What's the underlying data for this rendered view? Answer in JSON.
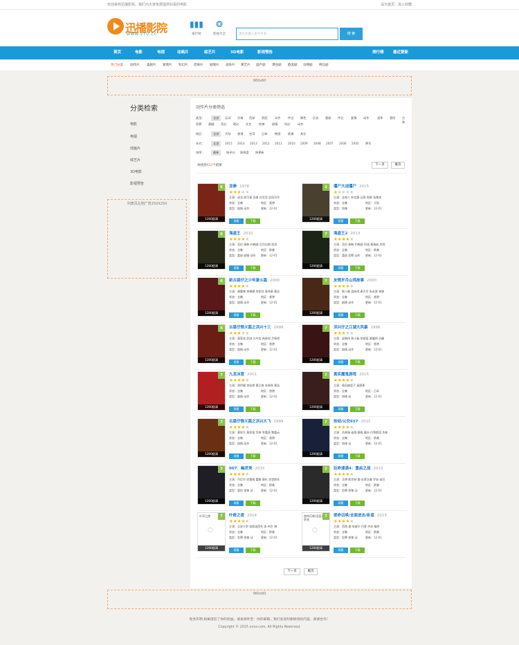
{
  "topbar": {
    "welcome": "欢迎来到迅播影院，我们为大家免费提供好看的电影",
    "links": "设为首页 · 加入收藏"
  },
  "header": {
    "logo_text": "迅播影院",
    "logo_url": "WWW.2TU.CC",
    "icon1_label": "排行榜",
    "icon2_label": "影视大全",
    "search_placeholder": "请在此输入影片片名",
    "search_button": "搜 索"
  },
  "nav": {
    "items": [
      "首页",
      "电影",
      "电视",
      "动画片",
      "综艺片",
      "3D电影",
      "影视预告"
    ],
    "right": [
      "排行榜",
      "最近更新"
    ]
  },
  "subnav": {
    "label": "热门分类：",
    "items": [
      "动作片",
      "喜剧片",
      "爱情片",
      "科幻片",
      "恐怖片",
      "剧情片",
      "战争片",
      "黄艺片",
      "国产剧",
      "港台剧",
      "欧美剧",
      "日韩剧",
      "韩马剧"
    ]
  },
  "ads": {
    "top": "960x60",
    "side": "列表页左侧广告250X250",
    "bottom": "960x60"
  },
  "sidebar": {
    "title": "分类检索",
    "links": [
      "电影",
      "电视",
      "动画片",
      "综艺片",
      "3D电影",
      "影视预告"
    ]
  },
  "filter": {
    "title": "动作片分类筛选",
    "type_label": "类型：",
    "type_items": [
      "全部",
      "运动",
      "灾难",
      "西部",
      "家庭",
      "动作",
      "传记",
      "情色",
      "历史",
      "喜剧",
      "传记",
      "爱情",
      "动作",
      "战争",
      "冒险",
      "古装",
      "犯罪",
      "悬疑",
      "奇幻",
      "歌幻",
      "文艺",
      "惊悚",
      "剧情",
      "科幻",
      "动作"
    ],
    "region_label": "地区：",
    "region_items": [
      "全部",
      "大陆",
      "香港",
      "台湾",
      "日本",
      "韩国",
      "欧美",
      "其它"
    ],
    "year_label": "年代：",
    "year_items": [
      "全部",
      "2015",
      "2014",
      "2013",
      "2012",
      "2011",
      "2010",
      "2009",
      "2008",
      "2007",
      "2006",
      "2005",
      "更早"
    ],
    "sort_label": "排序：",
    "sort_items": [
      "最新",
      "按评分",
      "按热度",
      "按更新"
    ]
  },
  "count": {
    "prefix": "共找到",
    "num": "922",
    "suffix": "个结果"
  },
  "pager": {
    "next": "下一页",
    "last": "尾页"
  },
  "labels": {
    "star": "主演：",
    "status": "状态：",
    "region": "地区：",
    "genre": "类型：",
    "update": "更新：",
    "watch": "观看",
    "download": "下载"
  },
  "movies": [
    {
      "title": "龙拳",
      "year": "1978",
      "rating": "6",
      "stars": 3,
      "actors": "成龙 邢可青 田俊 任世官 彭冈司华",
      "status": "全集",
      "region": "香港",
      "genre": "剧情 动作",
      "update": "12-01",
      "poster": "#7a2418"
    },
    {
      "title": "僵尸大战僵尸",
      "year": "2015",
      "rating": "2",
      "stars": 1,
      "actors": "金南人 朴信惠 吕燕 陈辉 张景良",
      "status": "全集",
      "region": "大陆",
      "genre": "惊悚",
      "update": "12-01",
      "poster": "#4a4030"
    },
    {
      "title": "海盗王",
      "year": "2010",
      "rating": "6",
      "stars": 4,
      "actors": "亚伦·泰勒-约翰逊 尼古拉斯·凯奇",
      "status": "全集",
      "region": "欧美",
      "genre": "喜剧 剧情 动作",
      "update": "12-01",
      "poster": "#2a2a18"
    },
    {
      "title": "海盗王2",
      "year": "2013",
      "rating": "7",
      "stars": 4,
      "actors": "亚伦·泰勒-约翰逊 科洛·莫瑞兹 克莉",
      "status": "全集",
      "region": "欧美",
      "genre": "喜剧 犯罪 动作",
      "update": "12-01",
      "poster": "#1c2418"
    },
    {
      "title": "新古惑仔之少年激斗篇",
      "year": "2000",
      "rating": "6",
      "stars": 4,
      "actors": "谢霆锋 李琳琳 何家劲 袁伟豪 黄志",
      "status": "全集",
      "region": "香港",
      "genre": "剧情 动作",
      "update": "12-01",
      "poster": "#5a1818"
    },
    {
      "title": "友情岁月山鸡故事",
      "year": "2000",
      "rating": "7",
      "stars": 4,
      "actors": "陈小春 梁咏琪 谢天华 朱永棠 林晓",
      "status": "全集",
      "region": "香港",
      "genre": "剧情 动作",
      "update": "12-01",
      "poster": "#4a2818"
    },
    {
      "title": "古惑仔情义篇之洪兴十三",
      "year": "1998",
      "rating": "6",
      "stars": 3,
      "actors": "莫家尧 舒淇 方中信 杨恭如 尹扬明",
      "status": "全集",
      "region": "香港",
      "genre": "剧情 动作",
      "update": "12-01",
      "poster": "#6a1e14"
    },
    {
      "title": "洪兴仔之江湖大风暴",
      "year": "1996",
      "rating": "7",
      "stars": 3,
      "actors": "梁朝伟 陈小春 李蓉蓉 黄耀明 谷峰",
      "status": "全集",
      "region": "香港",
      "genre": "剧情 动作",
      "update": "12-01",
      "poster": "#3a1414"
    },
    {
      "title": "九龙冰室",
      "year": "2001",
      "rating": "7",
      "stars": 4,
      "actors": "郑伊健 李彩桦 黄又南 朱咪咪 黄浩",
      "status": "全集",
      "region": "香港",
      "genre": "剧情 动作",
      "update": "12-01",
      "poster": "#b02020"
    },
    {
      "title": "真实魔鬼游戏",
      "year": "2015",
      "rating": "7",
      "stars": 4,
      "actors": "筱田麻里子 真野恵",
      "status": "全集",
      "region": "日本",
      "genre": "惊悚 动",
      "update": "12-01",
      "poster": "#3a1e1e"
    },
    {
      "title": "古惑仔情义篇之洪兴大飞",
      "year": "1999",
      "rating": "7",
      "stars": 4,
      "actors": "黄秋生 黄家强 苹婷 李嘉丽 覃嘉云",
      "status": "全集",
      "region": "香港",
      "genre": "剧情 动作",
      "update": "12-01",
      "poster": "#6a3014"
    },
    {
      "title": "抢劫/公交657",
      "year": "2015",
      "rating": "7",
      "stars": 4,
      "actors": "杰弗瑞·迪恩·摩根 戴夫·巴蒂斯塔 杰弗",
      "status": "全集",
      "region": "欧美",
      "genre": "惊悚 动",
      "update": "12-01",
      "poster": "#18203a"
    },
    {
      "title": "007：幽灵党",
      "year": "2015",
      "rating": "7",
      "stars": 4,
      "actors": "丹尼尔·克雷格 蕾雅·赛杜 克里斯托",
      "status": "全集",
      "region": "欧美",
      "genre": "冒险 惊悚 动",
      "update": "12-01",
      "poster": "#1e1e24"
    },
    {
      "title": "玩命速递4：重启之战",
      "year": "2015",
      "rating": "7",
      "stars": 4,
      "actors": "艾德·斯克林 雷·史蒂文森 罗安·迪巴",
      "status": "全集",
      "region": "欧美",
      "genre": "犯罪 惊悚 动",
      "update": "12-01",
      "poster": "#2a2a2a"
    },
    {
      "title": "叶奇之夜",
      "year": "2014",
      "rating": "7",
      "stars": 4,
      "actors": "吉安卡罗·埃斯波西托 凯·布尔 博",
      "status": "全集",
      "region": "欧美",
      "genre": "犯罪 惊悚 动",
      "update": "12-01",
      "poster": "#ffffff",
      "broken": "叶奇之夜"
    },
    {
      "title": "使命召唤/全面进击/卧底",
      "year": "2015",
      "rating": "7",
      "stars": 4,
      "actors": "西恩·潘 哈维尔·巴登 杰克·福特",
      "status": "全集",
      "region": "欧美",
      "genre": "犯罪 惊悚 动",
      "update": "12-01",
      "poster": "#ffffff",
      "broken": "使命召唤/全面进击/卧底"
    }
  ],
  "hd_label": "1280超清",
  "footer": {
    "line1": "免责声明:如果侵犯了你的权益，请发邮件至：你的邮箱，我们会及时删除侵权内容，谢谢合作！",
    "line2": "Copyright © 2015 xxxx.com. All Rights Reserved."
  }
}
